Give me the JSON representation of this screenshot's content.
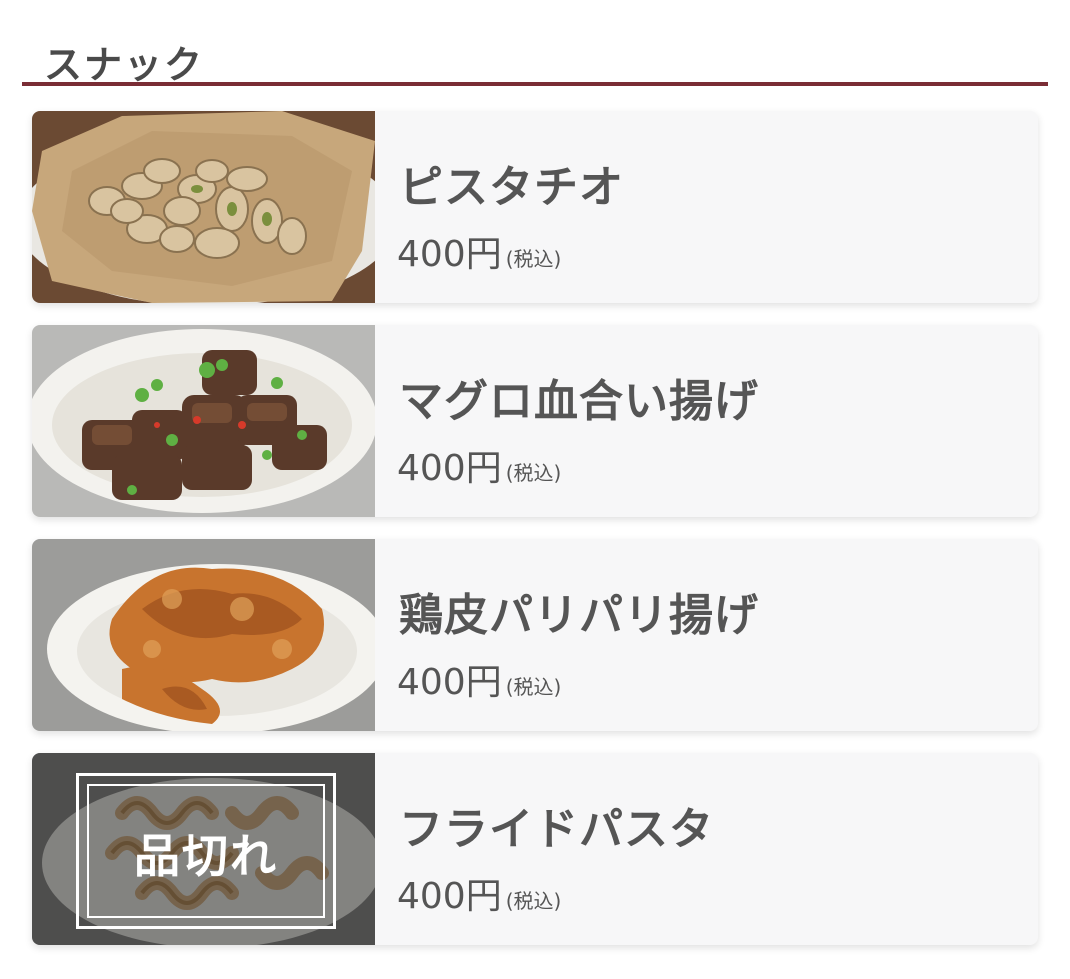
{
  "section": {
    "title": "スナック"
  },
  "items": [
    {
      "name": "ピスタチオ",
      "price": "400円",
      "tax": "(税込)",
      "image": "pistachio-photo"
    },
    {
      "name": "マグロ血合い揚げ",
      "price": "400円",
      "tax": "(税込)",
      "image": "fried-tuna-photo"
    },
    {
      "name": "鶏皮パリパリ揚げ",
      "price": "400円",
      "tax": "(税込)",
      "image": "fried-chicken-skin-photo"
    },
    {
      "name": "フライドパスタ",
      "price": "400円",
      "tax": "(税込)",
      "image": "fried-pasta-photo",
      "soldout_label": "品切れ"
    }
  ],
  "colors": {
    "accent_rule": "#7a2d35",
    "card_bg": "#f7f7f8",
    "text": "#555555"
  }
}
